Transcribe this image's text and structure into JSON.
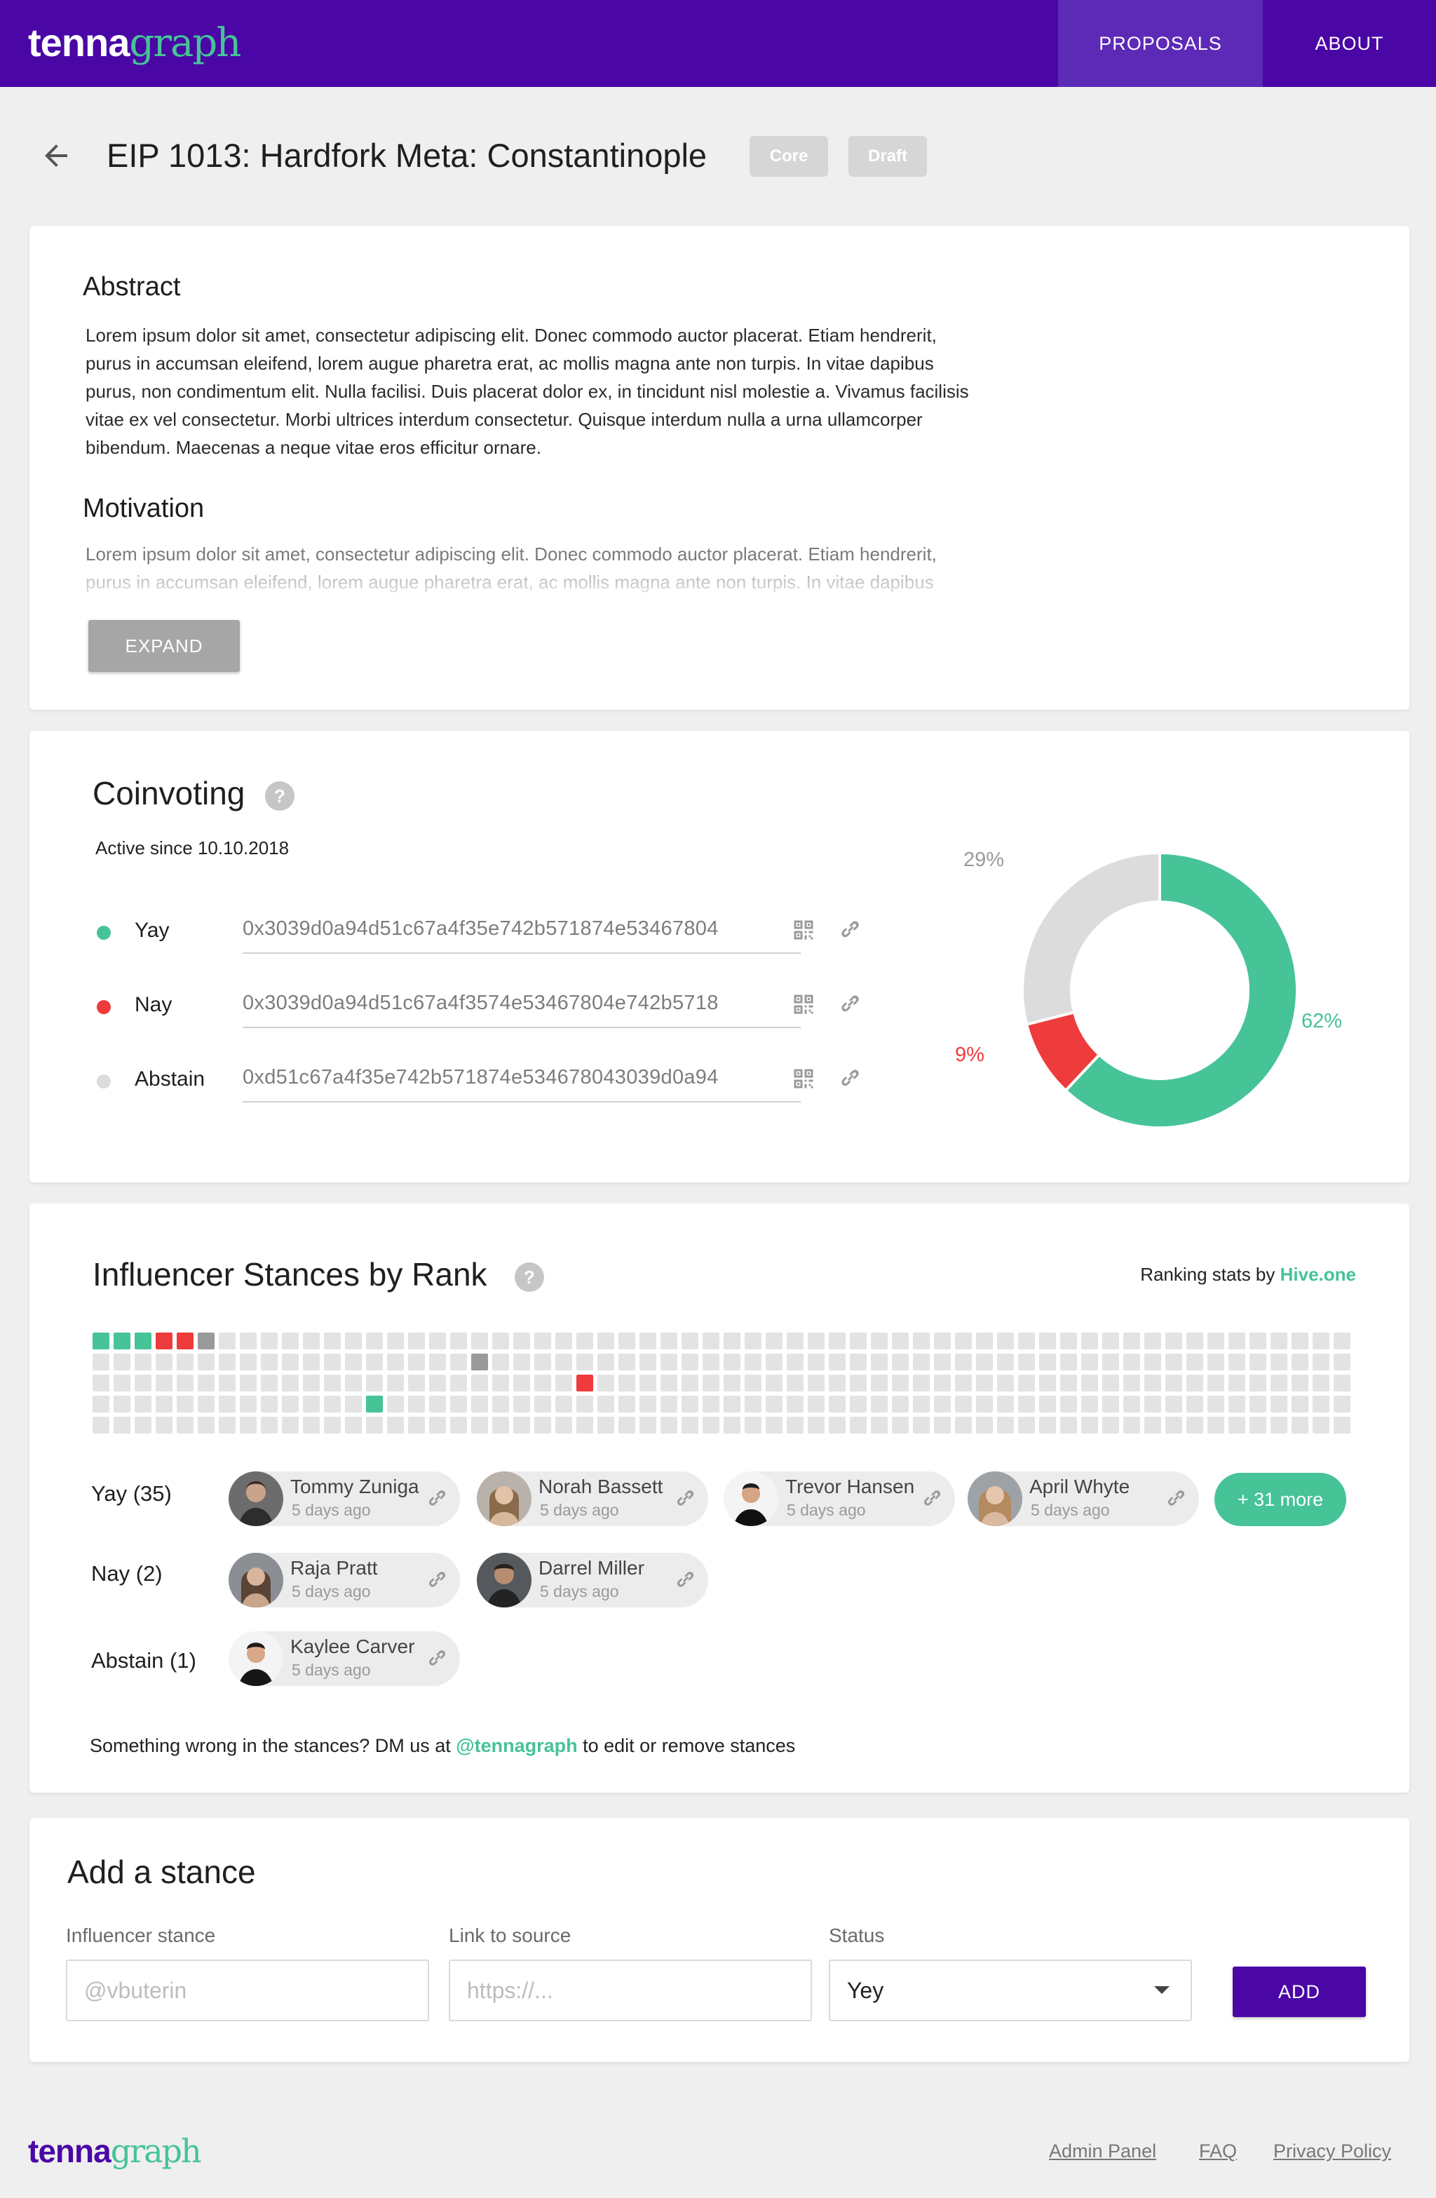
{
  "header": {
    "logo_part1": "tenna",
    "logo_part2": "graph",
    "nav": [
      "PROPOSALS",
      "ABOUT"
    ]
  },
  "proposal": {
    "title": "EIP 1013: Hardfork Meta: Constantinople",
    "tags": [
      "Core",
      "Draft"
    ]
  },
  "abstract": {
    "heading": "Abstract",
    "lines": [
      "Lorem ipsum dolor sit amet, consectetur adipiscing elit. Donec commodo auctor placerat. Etiam hendrerit,",
      "purus in accumsan eleifend, lorem augue pharetra erat, ac mollis magna ante non turpis. In vitae dapibus",
      "purus, non condimentum elit. Nulla facilisi. Duis placerat dolor ex, in tincidunt nisl molestie a. Vivamus facilisis",
      "vitae ex vel consectetur. Morbi ultrices interdum consectetur. Quisque interdum nulla a urna ullamcorper",
      "bibendum. Maecenas a neque vitae eros efficitur ornare."
    ]
  },
  "motivation": {
    "heading": "Motivation",
    "lines": [
      "Lorem ipsum dolor sit amet, consectetur adipiscing elit. Donec commodo auctor placerat. Etiam hendrerit,",
      "purus in accumsan eleifend, lorem augue pharetra erat, ac mollis magna ante non turpis. In vitae dapibus"
    ],
    "expand_label": "EXPAND"
  },
  "coinvoting": {
    "title": "Coinvoting",
    "help": "?",
    "active_since": "Active since 10.10.2018",
    "options": [
      {
        "label": "Yay",
        "address": "0x3039d0a94d51c67a4f35e742b571874e53467804",
        "color": "#46c397"
      },
      {
        "label": "Nay",
        "address": "0x3039d0a94d51c67a4f3574e53467804e742b5718",
        "color": "#ee3b3b"
      },
      {
        "label": "Abstain",
        "address": "0xd51c67a4f35e742b571874e534678043039d0a94",
        "color": "#dcdcdc"
      }
    ],
    "percent_labels": [
      "62%",
      "9%",
      "29%"
    ]
  },
  "chart_data": {
    "type": "pie",
    "categories": [
      "Yay",
      "Nay",
      "Abstain"
    ],
    "values": [
      62,
      9,
      29
    ],
    "colors": [
      "#46c397",
      "#ee3b3b",
      "#dcdcdc"
    ]
  },
  "influencers": {
    "title": "Influencer Stances by Rank",
    "help": "?",
    "ranking_prefix": "Ranking stats by ",
    "ranking_source": "Hive.one",
    "grid_columns": 60,
    "grid_rows": 5,
    "marked_cells": [
      {
        "row": 0,
        "col": 0,
        "color": "#46c397"
      },
      {
        "row": 0,
        "col": 1,
        "color": "#46c397"
      },
      {
        "row": 0,
        "col": 2,
        "color": "#46c397"
      },
      {
        "row": 0,
        "col": 3,
        "color": "#ee3b3b"
      },
      {
        "row": 0,
        "col": 4,
        "color": "#ee3b3b"
      },
      {
        "row": 0,
        "col": 5,
        "color": "#9a9a9a"
      },
      {
        "row": 1,
        "col": 18,
        "color": "#9a9a9a"
      },
      {
        "row": 2,
        "col": 23,
        "color": "#ee3b3b"
      },
      {
        "row": 3,
        "col": 13,
        "color": "#46c397"
      }
    ],
    "groups": [
      {
        "label": "Yay (35)",
        "people": [
          {
            "name": "Tommy Zuniga",
            "time": "5 days ago"
          },
          {
            "name": "Norah Bassett",
            "time": "5 days ago"
          },
          {
            "name": "Trevor Hansen",
            "time": "5 days ago"
          },
          {
            "name": "April Whyte",
            "time": "5 days ago"
          }
        ],
        "more": "+ 31 more"
      },
      {
        "label": "Nay (2)",
        "people": [
          {
            "name": "Raja Pratt",
            "time": "5 days ago"
          },
          {
            "name": "Darrel Miller",
            "time": "5 days ago"
          }
        ]
      },
      {
        "label": "Abstain (1)",
        "people": [
          {
            "name": "Kaylee Carver",
            "time": "5 days ago"
          }
        ]
      }
    ],
    "footer_prefix": "Something wrong in the stances? DM us at ",
    "footer_handle": "@tennagraph",
    "footer_suffix": " to edit or remove stances"
  },
  "add_stance": {
    "title": "Add a stance",
    "fields": [
      {
        "label": "Influencer stance",
        "placeholder": "@vbuterin"
      },
      {
        "label": "Link to source",
        "placeholder": "https://..."
      },
      {
        "label": "Status",
        "value": "Yey"
      }
    ],
    "button": "ADD"
  },
  "footer": {
    "logo_part1": "tenna",
    "logo_part2": "graph",
    "links": [
      "Admin Panel",
      "FAQ",
      "Privacy Policy"
    ]
  }
}
